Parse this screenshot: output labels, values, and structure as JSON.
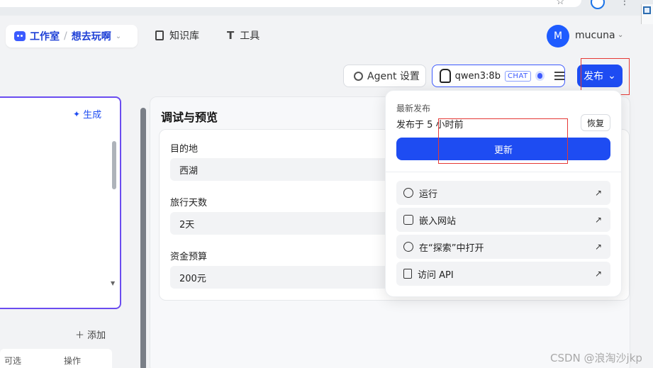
{
  "browser": {
    "star": "☆",
    "menu": "⋮"
  },
  "header": {
    "breadcrumb": [
      "工作室",
      "/",
      "想去玩啊"
    ],
    "nav": [
      {
        "label": "知识库",
        "icon": "book-icon"
      },
      {
        "label": "工具",
        "icon": "tool-icon"
      }
    ],
    "user": {
      "avatar_letter": "M",
      "name": "mucuna"
    }
  },
  "toolbar": {
    "agent_settings": "Agent 设置",
    "model": {
      "name": "qwen3:8b",
      "badge": "CHAT"
    },
    "publish": "发布"
  },
  "left_panel": {
    "generate": "生成",
    "add": "添加",
    "table_headers": [
      "可选",
      "操作"
    ]
  },
  "debug": {
    "title": "调试与预览",
    "fields": [
      {
        "label": "目的地",
        "value": "西湖"
      },
      {
        "label": "旅行天数",
        "value": "2天"
      },
      {
        "label": "资金预算",
        "value": "200元"
      }
    ]
  },
  "publish_menu": {
    "subtitle": "最新发布",
    "time": "发布于 5 小时前",
    "restore": "恢复",
    "update": "更新",
    "items": [
      {
        "label": "运行",
        "icon": "play-icon"
      },
      {
        "label": "嵌入网站",
        "icon": "embed-icon"
      },
      {
        "label": "在“探索”中打开",
        "icon": "explore-icon"
      },
      {
        "label": "访问 API",
        "icon": "document-icon"
      }
    ]
  },
  "watermark": "CSDN @浪淘沙jkp",
  "colors": {
    "primary": "#1e4cf2",
    "accent": "#6a4cf0",
    "annotation": "#e53935"
  }
}
